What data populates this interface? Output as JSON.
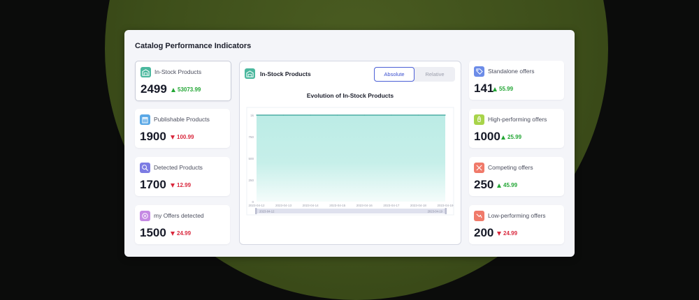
{
  "panel": {
    "title": "Catalog Performance Indicators"
  },
  "left_cards": [
    {
      "label": "In-Stock Products",
      "value": "2499",
      "delta": "53073.99",
      "trend": "up",
      "color": "#4bb89e",
      "icon": "warehouse-icon"
    },
    {
      "label": "Publishable Products",
      "value": "1900",
      "delta": "100.99",
      "trend": "down",
      "color": "#5aa8e6",
      "icon": "store-icon"
    },
    {
      "label": "Detected Products",
      "value": "1700",
      "delta": "12.99",
      "trend": "down",
      "color": "#7d7ce3",
      "icon": "detect-icon"
    },
    {
      "label": "my Offers detected",
      "value": "1500",
      "delta": "24.99",
      "trend": "down",
      "color": "#c58ae3",
      "icon": "offer-icon"
    }
  ],
  "right_cards": [
    {
      "label": "Standalone offers",
      "value": "141",
      "delta": "55.99",
      "trend": "up",
      "color": "#6c8ce8",
      "icon": "tag-icon"
    },
    {
      "label": "High-performing offers",
      "value": "1000",
      "delta": "25.99",
      "trend": "up",
      "color": "#a8d44a",
      "icon": "rocket-icon"
    },
    {
      "label": "Competing offers",
      "value": "250",
      "delta": "45.99",
      "trend": "up",
      "color": "#f07a6a",
      "icon": "compete-icon"
    },
    {
      "label": "Low-performing offers",
      "value": "200",
      "delta": "24.99",
      "trend": "down",
      "color": "#f07a6a",
      "icon": "low-icon"
    }
  ],
  "chart_panel": {
    "title": "In-Stock Products",
    "toggle": {
      "absolute": "Absolute",
      "relative": "Relative",
      "active": "absolute"
    }
  },
  "chart_data": {
    "type": "area",
    "title": "Evolution of In-Stock Products",
    "x": [
      "2023-04-12",
      "2023-04-13",
      "2023-04-14",
      "2023-04-15",
      "2023-04-16",
      "2023-04-17",
      "2023-04-18",
      "2023-04-19"
    ],
    "series": [
      {
        "values": [
          1000,
          1000,
          1000,
          1000,
          1000,
          1000,
          1000,
          1000
        ]
      }
    ],
    "y_ticks": [
      "0",
      "250",
      "500",
      "750",
      "1k"
    ],
    "ylim": [
      0,
      1000
    ],
    "range_selector": {
      "start": "2023-04-12",
      "end": "2023-04-19"
    },
    "line_color": "#2f9e93",
    "fill_color": "#b8ebe4",
    "grid": false
  }
}
